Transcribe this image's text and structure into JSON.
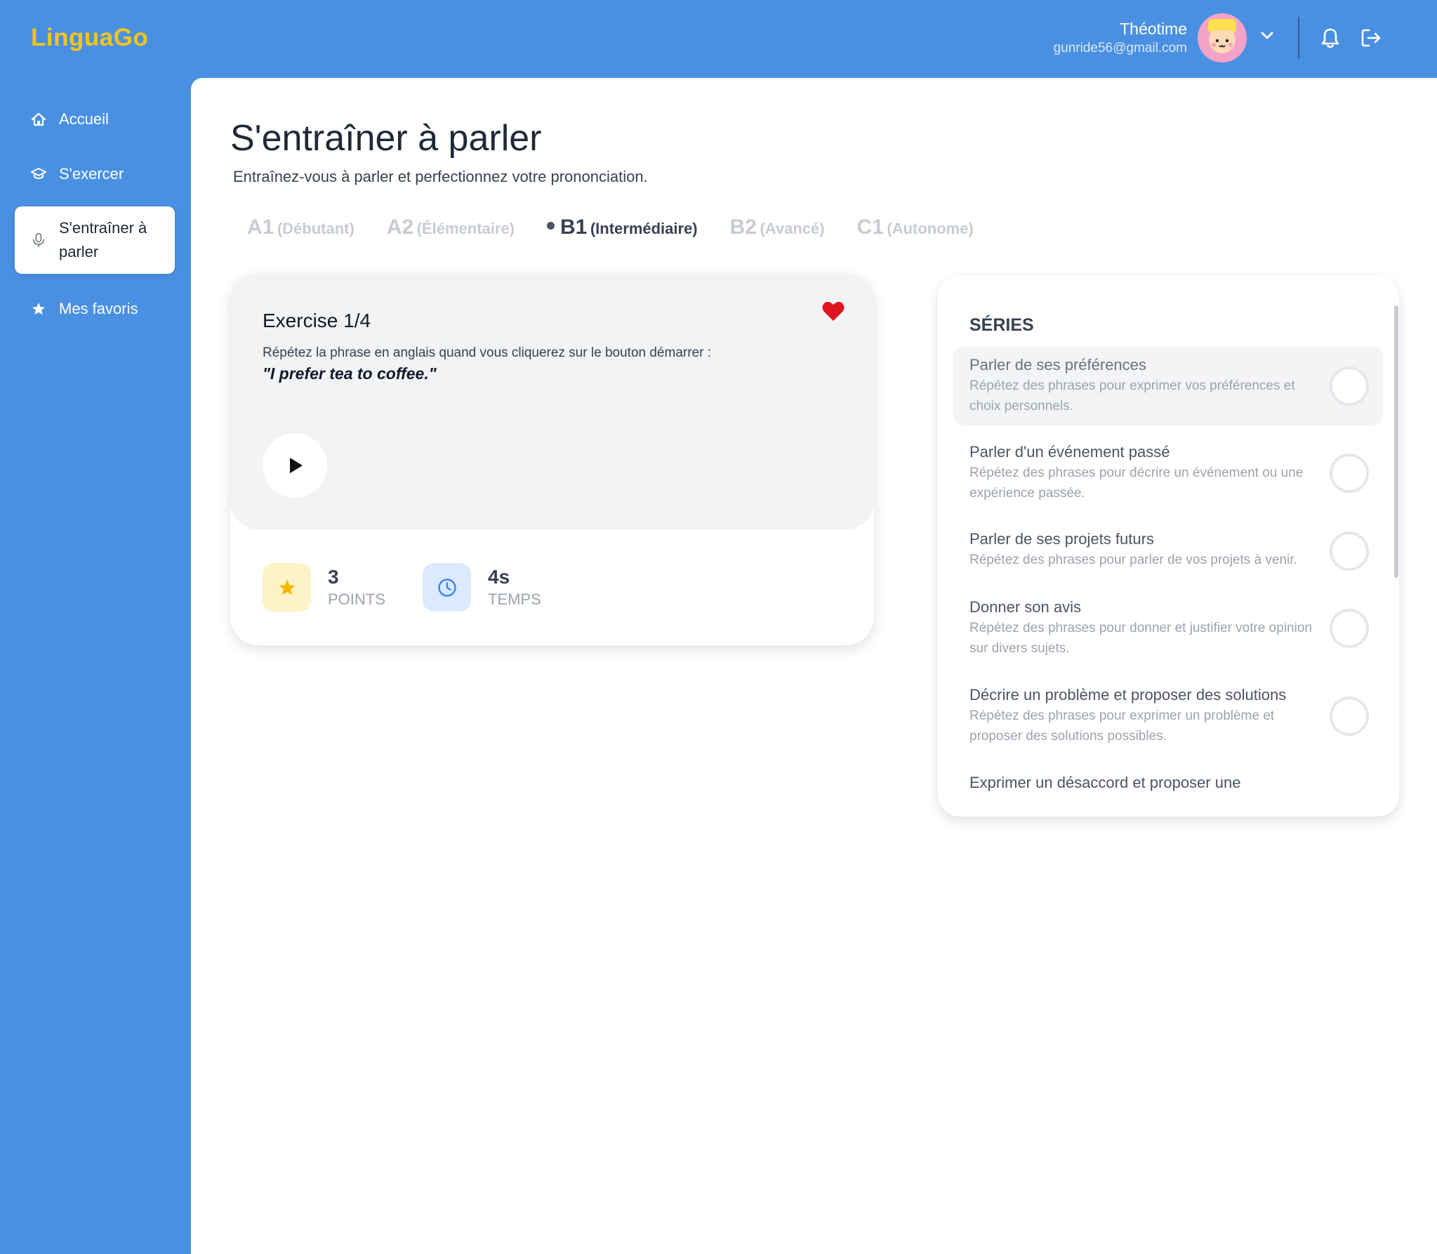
{
  "app": {
    "logo": "LinguaGo"
  },
  "user": {
    "name": "Théotime",
    "email": "gunride56@gmail.com"
  },
  "sidebar": {
    "items": [
      {
        "label": "Accueil",
        "icon": "home-icon",
        "active": false
      },
      {
        "label": "S'exercer",
        "icon": "graduation-cap-icon",
        "active": false
      },
      {
        "label": "S'entraîner à parler",
        "icon": "microphone-icon",
        "active": true
      },
      {
        "label": "Mes favoris",
        "icon": "star-icon",
        "active": false
      }
    ]
  },
  "page": {
    "title": "S'entraîner à parler",
    "subtitle": "Entraînez-vous à parler et perfectionnez votre prononciation."
  },
  "levels": [
    {
      "code": "A1",
      "name": "(Débutant)",
      "active": false
    },
    {
      "code": "A2",
      "name": "(Élémentaire)",
      "active": false
    },
    {
      "code": "B1",
      "name": "(Intermédiaire)",
      "active": true
    },
    {
      "code": "B2",
      "name": "(Avancé)",
      "active": false
    },
    {
      "code": "C1",
      "name": "(Autonome)",
      "active": false
    }
  ],
  "exercise": {
    "title": "Exercise 1/4",
    "instruction": "Répétez la phrase en anglais quand vous cliquerez sur le bouton démarrer :",
    "phrase": "\"I prefer tea to coffee.\"",
    "favorite": true,
    "stats": {
      "points": {
        "value": "3",
        "label": "POINTS"
      },
      "time": {
        "value": "4s",
        "label": "TEMPS"
      }
    }
  },
  "series": {
    "heading": "SÉRIES",
    "items": [
      {
        "title": "Parler de ses préférences",
        "desc": "Répétez des phrases pour exprimer vos préférences et choix personnels.",
        "selected": true
      },
      {
        "title": "Parler d'un événement passé",
        "desc": "Répétez des phrases pour décrire un événement ou une expérience passée.",
        "selected": false
      },
      {
        "title": "Parler de ses projets futurs",
        "desc": "Répétez des phrases pour parler de vos projets à venir.",
        "selected": false
      },
      {
        "title": "Donner son avis",
        "desc": "Répétez des phrases pour donner et justifier votre opinion sur divers sujets.",
        "selected": false
      },
      {
        "title": "Décrire un problème et proposer des solutions",
        "desc": "Répétez des phrases pour exprimer un problème et proposer des solutions possibles.",
        "selected": false
      },
      {
        "title": "Exprimer un désaccord et proposer une",
        "desc": "",
        "selected": false
      }
    ]
  },
  "colors": {
    "brand_blue": "#4a90e2",
    "logo_yellow": "#f5c518",
    "heart_red": "#e0141e",
    "points_bg": "#fef3c7",
    "time_bg": "#dbeafe"
  }
}
